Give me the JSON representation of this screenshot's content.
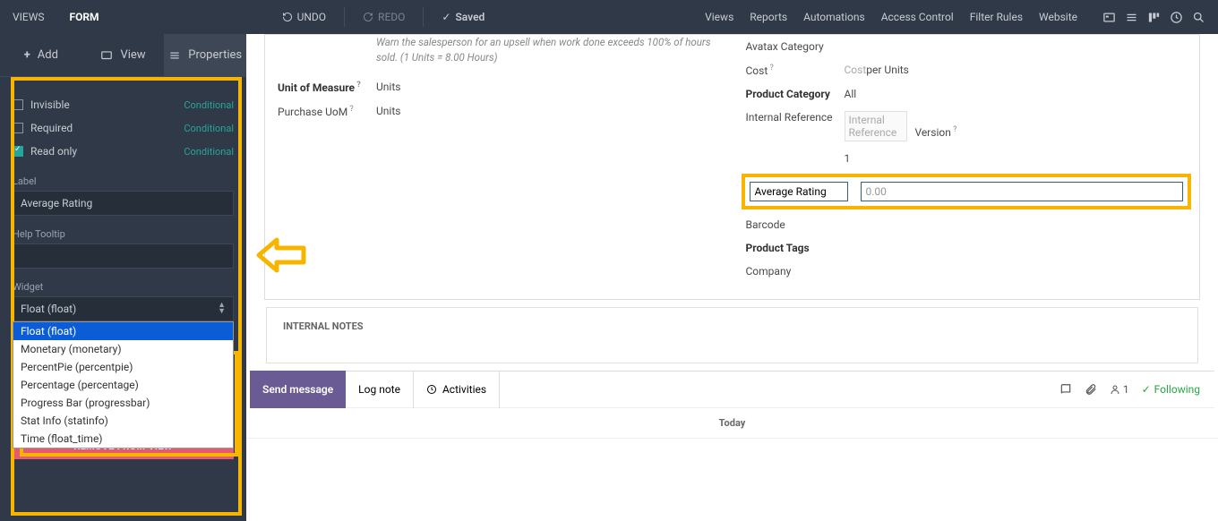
{
  "topbar": {
    "views": "VIEWS",
    "form": "FORM",
    "undo": "UNDO",
    "redo": "REDO",
    "saved": "Saved",
    "menu": {
      "views": "Views",
      "reports": "Reports",
      "automations": "Automations",
      "access": "Access Control",
      "filter": "Filter Rules",
      "website": "Website"
    }
  },
  "sidetabs": {
    "add": "Add",
    "view": "View",
    "properties": "Properties"
  },
  "props": {
    "invisible": "Invisible",
    "required": "Required",
    "readonly": "Read only",
    "cond": "Conditional",
    "label_lbl": "Label",
    "label_val": "Average Rating",
    "tooltip_lbl": "Help Tooltip",
    "tooltip_val": "",
    "widget_lbl": "Widget",
    "widget_val": "Float (float)",
    "options": {
      "float": "Float (float)",
      "monetary": "Monetary (monetary)",
      "percentpie": "PercentPie (percentpie)",
      "percentage": "Percentage (percentage)",
      "progressbar": "Progress Bar (progressbar)",
      "statinfo": "Stat Info (statinfo)",
      "time": "Time (float_time)"
    },
    "remove": "REMOVE FROM VIEW"
  },
  "form": {
    "warn": "Warn the salesperson for an upsell when work done exceeds 100% of hours sold. (1 Units = 8.00 Hours)",
    "uom_lbl": "Unit of Measure",
    "uom_val": "Units",
    "puom_lbl": "Purchase UoM",
    "puom_val": "Units",
    "avatax": "Avatax Category",
    "cost_lbl": "Cost",
    "cost_ph": "Cost",
    "cost_suffix": "per Units",
    "pcat_lbl": "Product Category",
    "pcat_val": "All",
    "iref_lbl": "Internal Reference",
    "iref_ph": "Internal Reference",
    "ver_lbl": "Version",
    "one": "1",
    "avg_lbl": "Average Rating",
    "avg_val": "0.00",
    "barcode": "Barcode",
    "ptags": "Product Tags",
    "company": "Company",
    "notes": "INTERNAL NOTES"
  },
  "msg": {
    "send": "Send message",
    "log": "Log note",
    "act": "Activities",
    "follow": "Following",
    "count": "1",
    "today": "Today"
  }
}
